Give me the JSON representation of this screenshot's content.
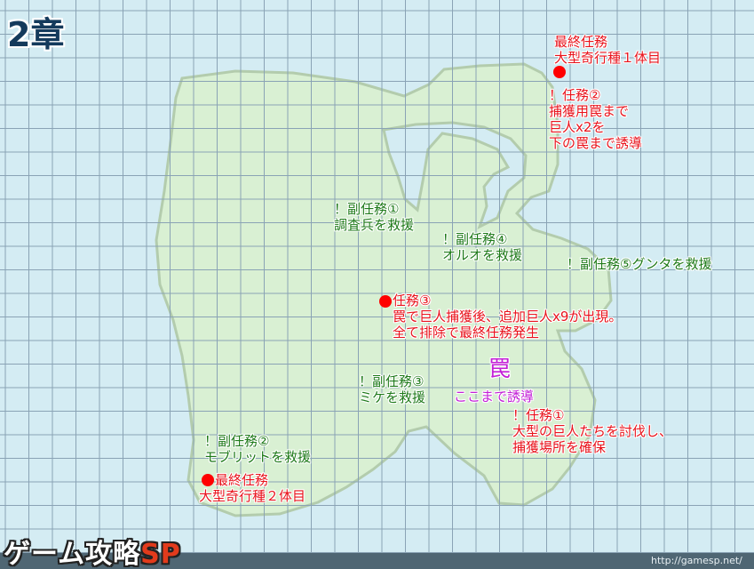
{
  "title": "2章",
  "logo": {
    "main": "ゲーム攻略",
    "accent": "SP"
  },
  "url": "http://gamesp.net/",
  "colors": {
    "sea": "#d4ecf3",
    "grid": "#8aa3b5",
    "land": "#d9f0d3",
    "land_border": "#b3ccad",
    "red": "#e8131c",
    "green": "#1e7a19",
    "purple": "#c21fd6"
  },
  "markers": {
    "final1": {
      "text": "最終任務\n大型奇行種１体目"
    },
    "mission2": {
      "text": "！任務②\n捕獲用罠まで\n巨人x2を\n下の罠まで誘導"
    },
    "sub1": {
      "text": "！副任務①\n調査兵を救援"
    },
    "sub4": {
      "text": "！副任務④\nオルオを救援"
    },
    "sub5": {
      "text": "！副任務⑤グンタを救援"
    },
    "mission3": {
      "text": "任務③\n罠で巨人捕獲後、追加巨人x9が出現。\n全て排除で最終任務発生"
    },
    "trap": {
      "title": "罠",
      "text": "ここまで誘導"
    },
    "sub3": {
      "text": "！副任務③\nミケを救援"
    },
    "mission1": {
      "text": "！任務①\n大型の巨人たちを討伐し、\n捕獲場所を確保"
    },
    "sub2": {
      "text": "！副任務②\nモブリットを救援"
    },
    "final2": {
      "text": "最終任務\n大型奇行種２体目"
    }
  }
}
